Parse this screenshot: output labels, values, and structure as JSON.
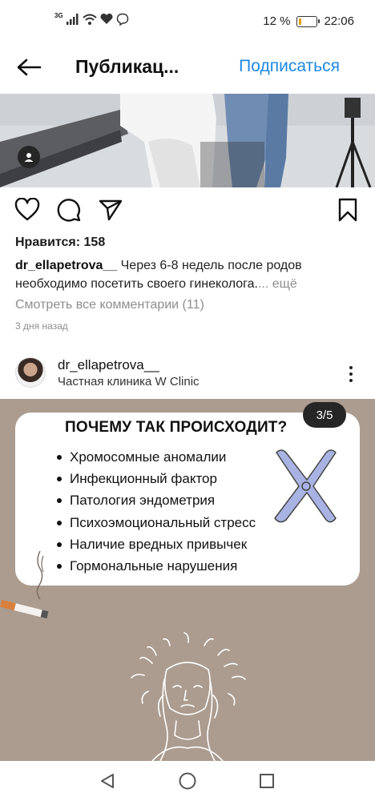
{
  "status_bar": {
    "network_label": "3G",
    "battery_percent": "12 %",
    "battery_level": 0.12,
    "time": "22:06"
  },
  "header": {
    "title": "Публикац...",
    "subscribe_label": "Подписаться"
  },
  "post": {
    "likes": "Нравится: 158",
    "author": "dr_ellapetrova__",
    "caption": " Через 6-8 недель после родов необходимо посетить своего гинеколога.",
    "more_label": "... ещё",
    "view_comments": "Смотреть все комментарии (11)",
    "time_ago": "3 дня назад"
  },
  "next_post": {
    "username": "dr_ellapetrova__",
    "location": "Частная клиника W Clinic",
    "slide": {
      "title": "ПОЧЕМУ ТАК ПРОИСХОДИТ?",
      "counter": "3/5",
      "items": [
        "Хромосомные аномалии",
        "Инфекционный фактор",
        "Патология эндометрия",
        "Психоэмоциональный стресс",
        "Наличие вредных привычек",
        "Гормональные нарушения"
      ]
    }
  },
  "icons": {
    "back": "arrow-left-icon",
    "like": "heart-icon",
    "comment": "comment-icon",
    "share": "send-icon",
    "save": "bookmark-icon",
    "tag": "user-tag-icon",
    "menu": "more-vertical-icon"
  },
  "colors": {
    "accent": "#1e88e5",
    "slide_background": "#ab9c8f",
    "chromosome": "#a9b3e3",
    "muted_text": "#8e8e8e"
  }
}
